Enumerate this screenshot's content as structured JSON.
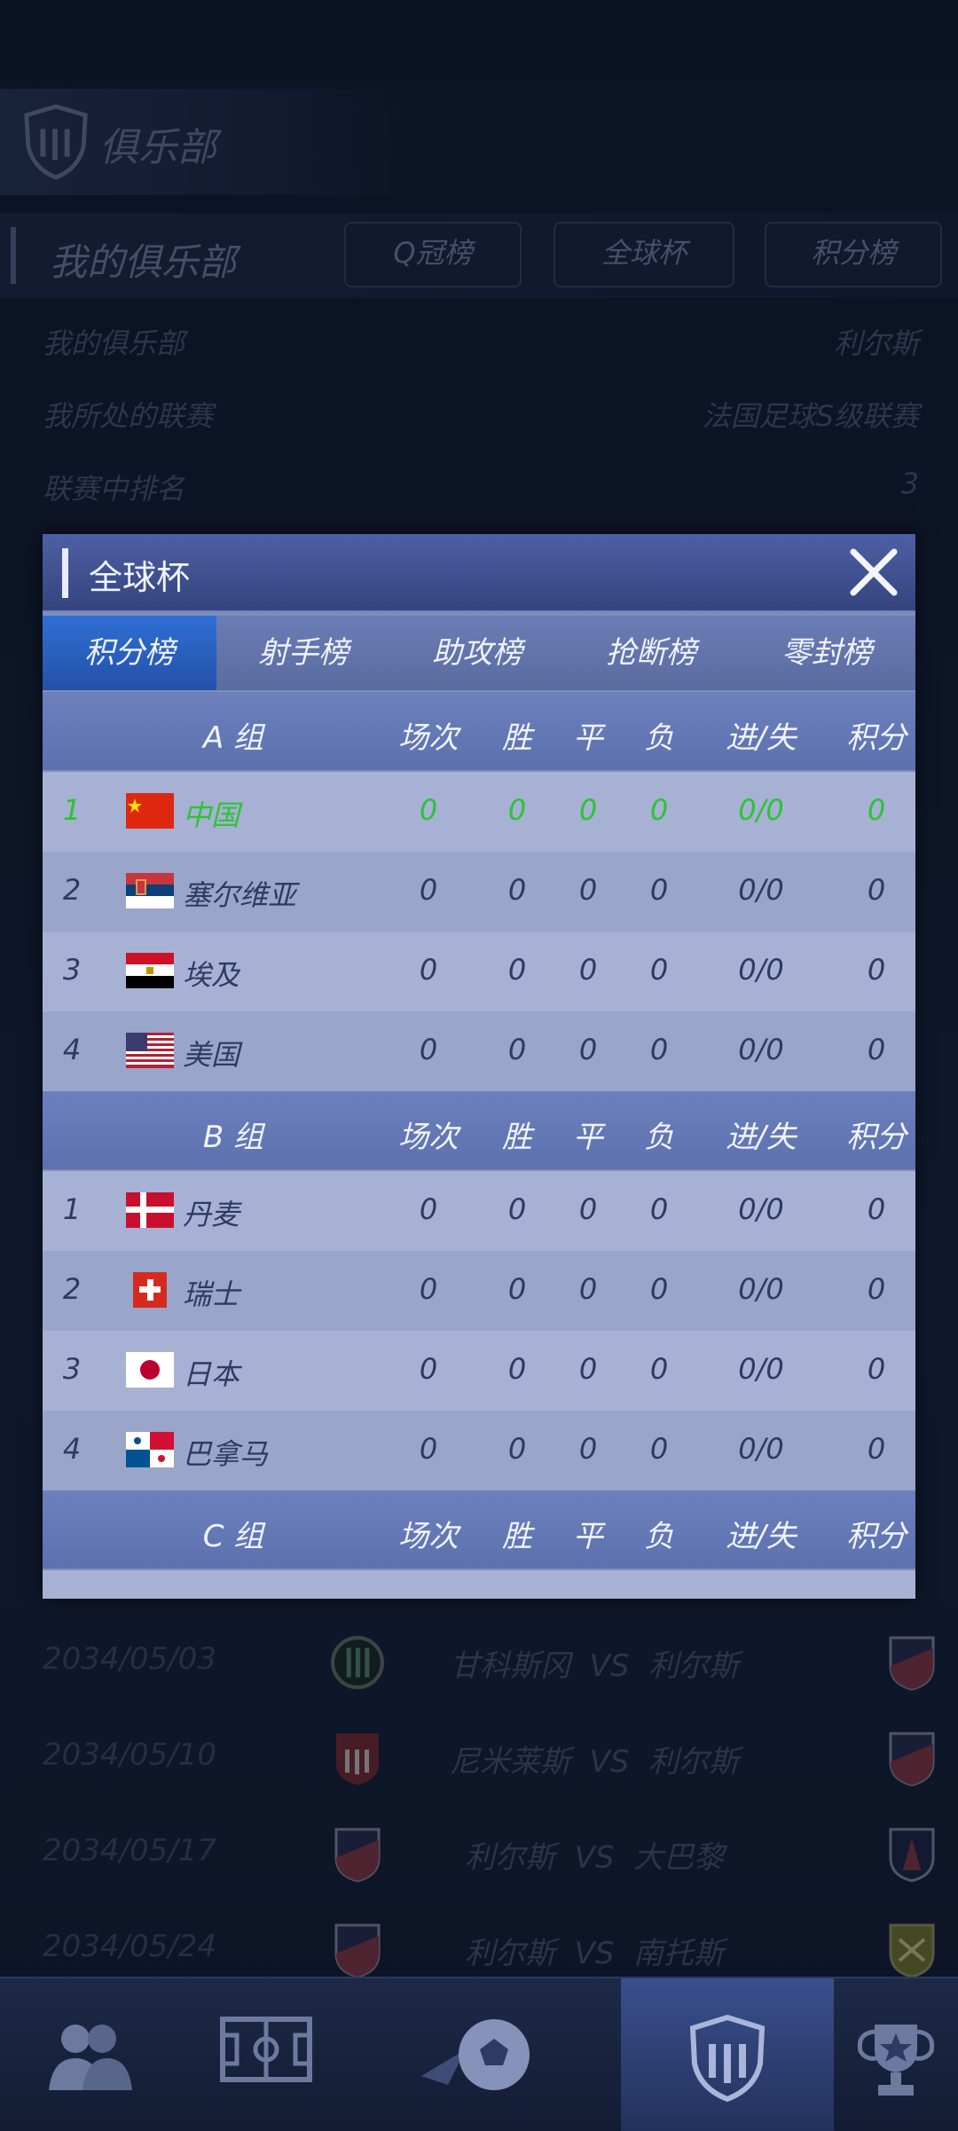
{
  "background": {
    "header_title": "俱乐部",
    "my_club_title": "我的俱乐部",
    "pills": [
      "Q冠榜",
      "全球杯",
      "积分榜"
    ],
    "info": [
      {
        "key": "我的俱乐部",
        "value": "利尔斯"
      },
      {
        "key": "我所处的联赛",
        "value": "法国足球S级联赛"
      },
      {
        "key": "联赛中排名",
        "value": "3"
      }
    ],
    "matches": [
      {
        "date": "2034/05/03",
        "home": "甘科斯冈",
        "vs": "VS",
        "away": "利尔斯"
      },
      {
        "date": "2034/05/10",
        "home": "尼米莱斯",
        "vs": "VS",
        "away": "利尔斯"
      },
      {
        "date": "2034/05/17",
        "home": "利尔斯",
        "vs": "VS",
        "away": "大巴黎"
      },
      {
        "date": "2034/05/24",
        "home": "利尔斯",
        "vs": "VS",
        "away": "南托斯"
      }
    ]
  },
  "modal": {
    "title": "全球杯",
    "tabs": [
      "积分榜",
      "射手榜",
      "助攻榜",
      "抢断榜",
      "零封榜"
    ],
    "active_tab": "积分榜",
    "columns": [
      "场次",
      "胜",
      "平",
      "负",
      "进/失",
      "积分"
    ],
    "groups": [
      {
        "name": "A 组",
        "rows": [
          {
            "rank": "1",
            "country": "中国",
            "played": "0",
            "win": "0",
            "draw": "0",
            "loss": "0",
            "goals": "0/0",
            "points": "0",
            "flag": "cn"
          },
          {
            "rank": "2",
            "country": "塞尔维亚",
            "played": "0",
            "win": "0",
            "draw": "0",
            "loss": "0",
            "goals": "0/0",
            "points": "0",
            "flag": "rs"
          },
          {
            "rank": "3",
            "country": "埃及",
            "played": "0",
            "win": "0",
            "draw": "0",
            "loss": "0",
            "goals": "0/0",
            "points": "0",
            "flag": "eg"
          },
          {
            "rank": "4",
            "country": "美国",
            "played": "0",
            "win": "0",
            "draw": "0",
            "loss": "0",
            "goals": "0/0",
            "points": "0",
            "flag": "us"
          }
        ]
      },
      {
        "name": "B 组",
        "rows": [
          {
            "rank": "1",
            "country": "丹麦",
            "played": "0",
            "win": "0",
            "draw": "0",
            "loss": "0",
            "goals": "0/0",
            "points": "0",
            "flag": "dk"
          },
          {
            "rank": "2",
            "country": "瑞士",
            "played": "0",
            "win": "0",
            "draw": "0",
            "loss": "0",
            "goals": "0/0",
            "points": "0",
            "flag": "ch"
          },
          {
            "rank": "3",
            "country": "日本",
            "played": "0",
            "win": "0",
            "draw": "0",
            "loss": "0",
            "goals": "0/0",
            "points": "0",
            "flag": "jp"
          },
          {
            "rank": "4",
            "country": "巴拿马",
            "played": "0",
            "win": "0",
            "draw": "0",
            "loss": "0",
            "goals": "0/0",
            "points": "0",
            "flag": "pa"
          }
        ]
      },
      {
        "name": "C 组",
        "rows": []
      }
    ],
    "highlight_color": "#2cc434"
  },
  "bottom_nav": {
    "icons": [
      "players-icon",
      "pitch-icon",
      "match-ball-icon",
      "club-shield-icon",
      "trophy-icon"
    ],
    "active": "club-shield-icon"
  }
}
